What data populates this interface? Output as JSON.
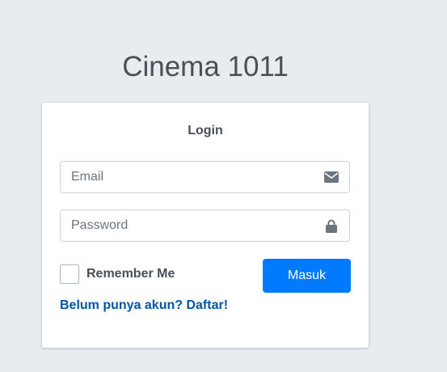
{
  "app": {
    "title": "Cinema 1011"
  },
  "login_card": {
    "header": "Login",
    "email": {
      "placeholder": "Email",
      "value": "",
      "icon": "envelope-icon"
    },
    "password": {
      "placeholder": "Password",
      "value": "",
      "icon": "lock-icon"
    },
    "remember_label": "Remember Me",
    "remember_checked": false,
    "submit_label": "Masuk",
    "register_link": "Belum punya akun? Daftar!"
  },
  "colors": {
    "background": "#e9ecef",
    "primary_button": "#007bff",
    "link": "#0055a5",
    "text": "#495057"
  }
}
